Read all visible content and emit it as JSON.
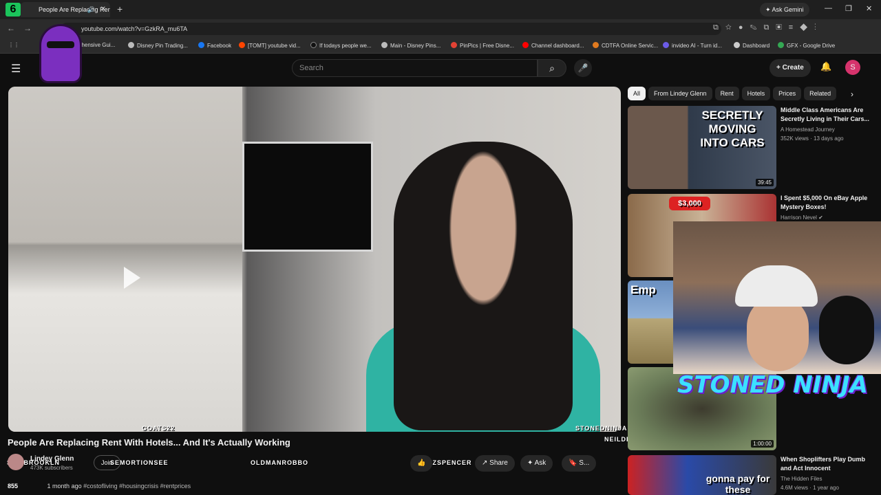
{
  "browser": {
    "tab_title": "People Are Replacing Rent",
    "url": "youtube.com/watch?v=GzkRA_mu6TA",
    "ask_gemini": "Ask Gemini",
    "window_controls": [
      "—",
      "❐",
      "✕"
    ]
  },
  "bookmarks": [
    {
      "label": "Comprehensive Gui...",
      "color": "#6b7280"
    },
    {
      "label": "Disney Pin Trading...",
      "color": "#bbbbbb"
    },
    {
      "label": "Facebook",
      "color": "#1877f2"
    },
    {
      "label": "[TOMT] youtube vid...",
      "color": "#ff4500"
    },
    {
      "label": "If todays people we...",
      "color": "#111111"
    },
    {
      "label": "Main - Disney Pins...",
      "color": "#bbbbbb"
    },
    {
      "label": "PinPics | Free Disne...",
      "color": "#e34234"
    },
    {
      "label": "Channel dashboard...",
      "color": "#ff0000"
    },
    {
      "label": "CDTFA Online Servic...",
      "color": "#e07a1f"
    },
    {
      "label": "invideo AI - Turn id...",
      "color": "#6c5ce7"
    },
    {
      "label": "Dashboard",
      "color": "#cccccc"
    },
    {
      "label": "GFX - Google Drive",
      "color": "#34a853"
    }
  ],
  "youtube": {
    "search_placeholder": "Search",
    "create_label": "Create",
    "avatar_letter": "S",
    "video_title": "People Are Replacing Rent With Hotels... And It's Actually Working",
    "channel_name": "Lindey Glenn",
    "subscribers": "473K subscribers",
    "join_label": "Join",
    "like_count": "",
    "share_label": "Share",
    "ask_label": "Ask",
    "save_label": "S...",
    "desc_views": "855",
    "desc_age": "1 month ago",
    "desc_tags": "#costofliving  #housingcrisis  #rentprices"
  },
  "overlays": {
    "logo_digit": "6",
    "names": [
      {
        "text": "GOATS22",
        "id": "goats22"
      },
      {
        "text": "STONEDNINJA",
        "id": "stonedninja"
      },
      {
        "text": "NEILDEGRASSETYRONE",
        "id": "neil"
      },
      {
        "text": "SIFUBROOKLN",
        "id": "sifu"
      },
      {
        "text": "SEMORTIONSEE",
        "id": "semortion"
      },
      {
        "text": "OLDMANROBBO",
        "id": "oldman"
      },
      {
        "text": "ZZSPENCER",
        "id": "zz"
      }
    ],
    "stoned_banner": "STONED NINJA"
  },
  "chips": [
    "All",
    "From Lindey Glenn",
    "Rent",
    "Hotels",
    "Prices",
    "Related"
  ],
  "recommendations": [
    {
      "title": "Middle Class Americans Are Secretly Living in Their Cars...",
      "channel": "A Homestead Journey",
      "meta": "352K views · 13 days ago",
      "duration": "39:45",
      "thumb_text": "SECRETLY MOVING INTO CARS"
    },
    {
      "title": "I Spent $5,000 On eBay Apple Mystery Boxes!",
      "channel": "Harrison Nevel",
      "meta": "",
      "duration": "",
      "thumb_text": "$3,000"
    },
    {
      "title": "",
      "channel": "",
      "meta": "",
      "duration": "",
      "thumb_text": "Emp"
    },
    {
      "title": "",
      "channel": "",
      "meta": "",
      "duration": "1:00:00",
      "thumb_text": ""
    },
    {
      "title": "When Shoplifters Play Dumb and Act Innocent",
      "channel": "The Hidden Files",
      "meta": "4.6M views · 1 year ago",
      "duration": "",
      "thumb_text": "gonna pay for these"
    }
  ]
}
